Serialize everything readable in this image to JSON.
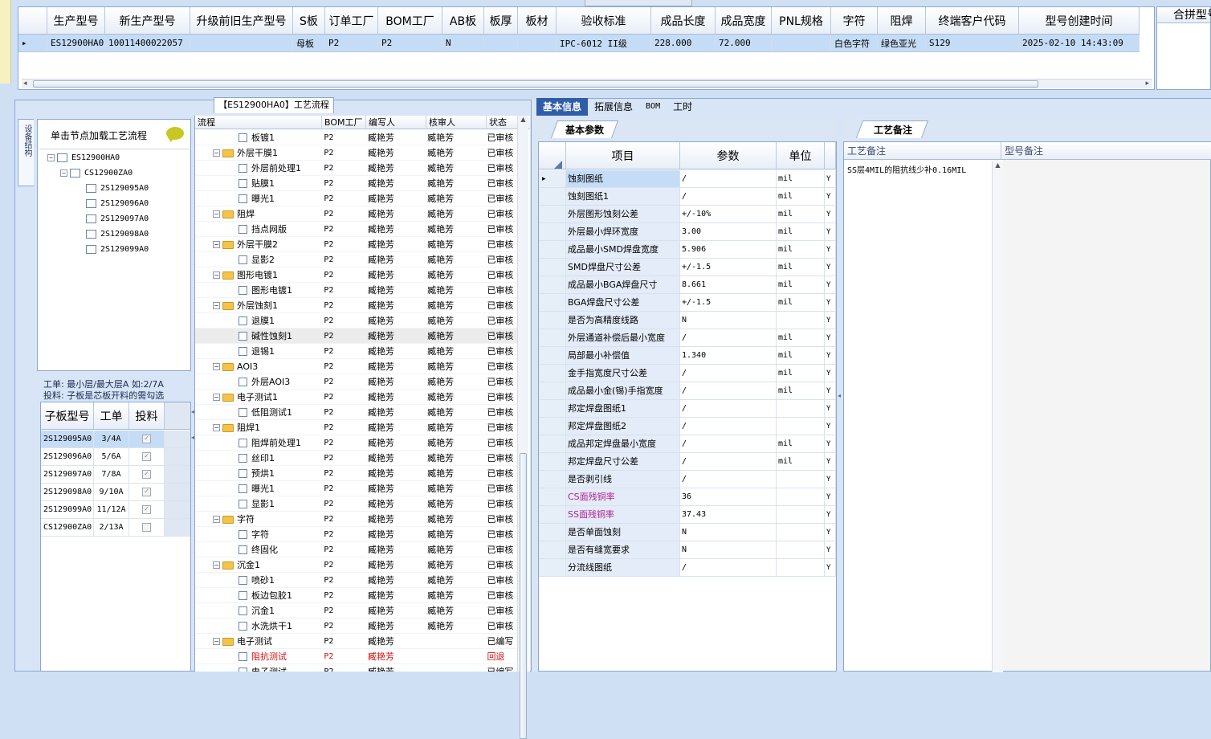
{
  "top_grid": {
    "columns": [
      "生产型号",
      "新生产型号",
      "升级前旧生产型号",
      "S板",
      "订单工厂",
      "BOM工厂",
      "AB板",
      "板厚",
      "板材",
      "验收标准",
      "成品长度",
      "成品宽度",
      "PNL规格",
      "字符",
      "阻焊",
      "终端客户代码",
      "型号创建时间"
    ],
    "row": [
      "ES12900HA0",
      "10011400022057",
      "",
      "母板",
      "P2",
      "P2",
      "N",
      "",
      "",
      "IPC-6012 II级",
      "228.000",
      "72.000",
      "",
      "白色字符",
      "绿色亚光",
      "S129",
      "2025-02-10 14:43:09"
    ],
    "right_header": "合拼型号"
  },
  "left_panel": {
    "vertical_tab": "设备结构",
    "hint": "单击节点加载工艺流程",
    "tree_root": "ES12900HA0",
    "tree_child": "CS12900ZA0",
    "tree_leaves": [
      "2S129095A0",
      "2S129096A0",
      "2S129097A0",
      "2S129098A0",
      "2S129099A0"
    ],
    "note_line1": "工单: 最小层/最大层A 如:2/7A",
    "note_line2": "投料: 子板是芯板开料的需勾选",
    "sub_columns": [
      "子板型号",
      "工单",
      "投料"
    ],
    "sub_rows": [
      {
        "model": "2S129095A0",
        "order": "3/4A",
        "checked": true
      },
      {
        "model": "2S129096A0",
        "order": "5/6A",
        "checked": true
      },
      {
        "model": "2S129097A0",
        "order": "7/8A",
        "checked": true
      },
      {
        "model": "2S129098A0",
        "order": "9/10A",
        "checked": true
      },
      {
        "model": "2S129099A0",
        "order": "11/12A",
        "checked": true
      },
      {
        "model": "CS12900ZA0",
        "order": "2/13A",
        "checked": false
      }
    ]
  },
  "flow_panel": {
    "title": "【ES12900HA0】工艺流程",
    "columns": [
      "流程",
      "BOM工厂",
      "编写人",
      "核审人",
      "状态"
    ],
    "rows": [
      {
        "name": "板镀1",
        "level": 2,
        "bom": "P2",
        "writer": "臧艳芳",
        "checker": "臧艳芳",
        "status": "已审核"
      },
      {
        "name": "外层干膜1",
        "level": 1,
        "bom": "P2",
        "writer": "臧艳芳",
        "checker": "臧艳芳",
        "status": "已审核"
      },
      {
        "name": "外层前处理1",
        "level": 2,
        "bom": "P2",
        "writer": "臧艳芳",
        "checker": "臧艳芳",
        "status": "已审核"
      },
      {
        "name": "贴膜1",
        "level": 2,
        "bom": "P2",
        "writer": "臧艳芳",
        "checker": "臧艳芳",
        "status": "已审核"
      },
      {
        "name": "曝光1",
        "level": 2,
        "bom": "P2",
        "writer": "臧艳芳",
        "checker": "臧艳芳",
        "status": "已审核"
      },
      {
        "name": "阻焊",
        "level": 1,
        "bom": "P2",
        "writer": "臧艳芳",
        "checker": "臧艳芳",
        "status": "已审核"
      },
      {
        "name": "挡点网版",
        "level": 2,
        "bom": "P2",
        "writer": "臧艳芳",
        "checker": "臧艳芳",
        "status": "已审核"
      },
      {
        "name": "外层干膜2",
        "level": 1,
        "bom": "P2",
        "writer": "臧艳芳",
        "checker": "臧艳芳",
        "status": "已审核"
      },
      {
        "name": "显影2",
        "level": 2,
        "bom": "P2",
        "writer": "臧艳芳",
        "checker": "臧艳芳",
        "status": "已审核"
      },
      {
        "name": "图形电镀1",
        "level": 1,
        "bom": "P2",
        "writer": "臧艳芳",
        "checker": "臧艳芳",
        "status": "已审核"
      },
      {
        "name": "图形电镀1",
        "level": 2,
        "bom": "P2",
        "writer": "臧艳芳",
        "checker": "臧艳芳",
        "status": "已审核"
      },
      {
        "name": "外层蚀刻1",
        "level": 1,
        "bom": "P2",
        "writer": "臧艳芳",
        "checker": "臧艳芳",
        "status": "已审核"
      },
      {
        "name": "退膜1",
        "level": 2,
        "bom": "P2",
        "writer": "臧艳芳",
        "checker": "臧艳芳",
        "status": "已审核"
      },
      {
        "name": "碱性蚀刻1",
        "level": 2,
        "bom": "P2",
        "writer": "臧艳芳",
        "checker": "臧艳芳",
        "status": "已审核",
        "selected": true
      },
      {
        "name": "退锡1",
        "level": 2,
        "bom": "P2",
        "writer": "臧艳芳",
        "checker": "臧艳芳",
        "status": "已审核"
      },
      {
        "name": "AOI3",
        "level": 1,
        "bom": "P2",
        "writer": "臧艳芳",
        "checker": "臧艳芳",
        "status": "已审核"
      },
      {
        "name": "外层AOI3",
        "level": 2,
        "bom": "P2",
        "writer": "臧艳芳",
        "checker": "臧艳芳",
        "status": "已审核"
      },
      {
        "name": "电子测试1",
        "level": 1,
        "bom": "P2",
        "writer": "臧艳芳",
        "checker": "臧艳芳",
        "status": "已审核"
      },
      {
        "name": "低阻测试1",
        "level": 2,
        "bom": "P2",
        "writer": "臧艳芳",
        "checker": "臧艳芳",
        "status": "已审核"
      },
      {
        "name": "阻焊1",
        "level": 1,
        "bom": "P2",
        "writer": "臧艳芳",
        "checker": "臧艳芳",
        "status": "已审核"
      },
      {
        "name": "阻焊前处理1",
        "level": 2,
        "bom": "P2",
        "writer": "臧艳芳",
        "checker": "臧艳芳",
        "status": "已审核"
      },
      {
        "name": "丝印1",
        "level": 2,
        "bom": "P2",
        "writer": "臧艳芳",
        "checker": "臧艳芳",
        "status": "已审核"
      },
      {
        "name": "预烘1",
        "level": 2,
        "bom": "P2",
        "writer": "臧艳芳",
        "checker": "臧艳芳",
        "status": "已审核"
      },
      {
        "name": "曝光1",
        "level": 2,
        "bom": "P2",
        "writer": "臧艳芳",
        "checker": "臧艳芳",
        "status": "已审核"
      },
      {
        "name": "显影1",
        "level": 2,
        "bom": "P2",
        "writer": "臧艳芳",
        "checker": "臧艳芳",
        "status": "已审核"
      },
      {
        "name": "字符",
        "level": 1,
        "bom": "P2",
        "writer": "臧艳芳",
        "checker": "臧艳芳",
        "status": "已审核"
      },
      {
        "name": "字符",
        "level": 2,
        "bom": "P2",
        "writer": "臧艳芳",
        "checker": "臧艳芳",
        "status": "已审核"
      },
      {
        "name": "终固化",
        "level": 2,
        "bom": "P2",
        "writer": "臧艳芳",
        "checker": "臧艳芳",
        "status": "已审核"
      },
      {
        "name": "沉金1",
        "level": 1,
        "bom": "P2",
        "writer": "臧艳芳",
        "checker": "臧艳芳",
        "status": "已审核"
      },
      {
        "name": "喷砂1",
        "level": 2,
        "bom": "P2",
        "writer": "臧艳芳",
        "checker": "臧艳芳",
        "status": "已审核"
      },
      {
        "name": "板边包胶1",
        "level": 2,
        "bom": "P2",
        "writer": "臧艳芳",
        "checker": "臧艳芳",
        "status": "已审核"
      },
      {
        "name": "沉金1",
        "level": 2,
        "bom": "P2",
        "writer": "臧艳芳",
        "checker": "臧艳芳",
        "status": "已审核"
      },
      {
        "name": "水洗烘干1",
        "level": 2,
        "bom": "P2",
        "writer": "臧艳芳",
        "checker": "臧艳芳",
        "status": "已审核"
      },
      {
        "name": "电子测试",
        "level": 1,
        "bom": "P2",
        "writer": "臧艳芳",
        "checker": "",
        "status": "已编写"
      },
      {
        "name": "阻抗测试",
        "level": 2,
        "bom": "P2",
        "writer": "臧艳芳",
        "checker": "",
        "status": "回退",
        "red": true
      },
      {
        "name": "电子测试",
        "level": 2,
        "bom": "P2",
        "writer": "臧艳芳",
        "checker": "",
        "status": "已编写"
      }
    ]
  },
  "right_tabs": [
    "基本信息",
    "拓展信息",
    "BOM",
    "工时"
  ],
  "params_tab": "基本参数",
  "params": {
    "columns": [
      "项目",
      "参数",
      "单位"
    ],
    "rows": [
      {
        "item": "蚀刻图纸",
        "param": "/",
        "unit": "mil",
        "flag": "Y",
        "current": true
      },
      {
        "item": "蚀刻图纸1",
        "param": "/",
        "unit": "mil",
        "flag": "Y"
      },
      {
        "item": "外层图形蚀刻公差",
        "param": "+/-10%",
        "unit": "mil",
        "flag": "Y"
      },
      {
        "item": "外层最小焊环宽度",
        "param": "3.00",
        "unit": "mil",
        "flag": "Y"
      },
      {
        "item": "成品最小SMD焊盘宽度",
        "param": "5.906",
        "unit": "mil",
        "flag": "Y"
      },
      {
        "item": "SMD焊盘尺寸公差",
        "param": "+/-1.5",
        "unit": "mil",
        "flag": "Y"
      },
      {
        "item": "成品最小BGA焊盘尺寸",
        "param": "8.661",
        "unit": "mil",
        "flag": "Y"
      },
      {
        "item": "BGA焊盘尺寸公差",
        "param": "+/-1.5",
        "unit": "mil",
        "flag": "Y"
      },
      {
        "item": "是否为高精度线路",
        "param": "N",
        "unit": "",
        "flag": "Y"
      },
      {
        "item": "外层通道补偿后最小宽度",
        "param": "/",
        "unit": "mil",
        "flag": "Y"
      },
      {
        "item": "局部最小补偿值",
        "param": "1.340",
        "unit": "mil",
        "flag": "Y"
      },
      {
        "item": "金手指宽度尺寸公差",
        "param": "/",
        "unit": "mil",
        "flag": "Y"
      },
      {
        "item": "成品最小金(锡)手指宽度",
        "param": "/",
        "unit": "mil",
        "flag": "Y"
      },
      {
        "item": "邦定焊盘图纸1",
        "param": "/",
        "unit": "",
        "flag": "Y"
      },
      {
        "item": "邦定焊盘图纸2",
        "param": "/",
        "unit": "",
        "flag": "Y"
      },
      {
        "item": "成品邦定焊盘最小宽度",
        "param": "/",
        "unit": "mil",
        "flag": "Y"
      },
      {
        "item": "邦定焊盘尺寸公差",
        "param": "/",
        "unit": "mil",
        "flag": "Y"
      },
      {
        "item": "是否剥引线",
        "param": "/",
        "unit": "",
        "flag": "Y"
      },
      {
        "item": "CS面残铜率",
        "param": "36",
        "unit": "",
        "flag": "Y",
        "pink": true
      },
      {
        "item": "SS面残铜率",
        "param": "37.43",
        "unit": "",
        "flag": "Y",
        "pink": true
      },
      {
        "item": "是否单面蚀刻",
        "param": "N",
        "unit": "",
        "flag": "Y"
      },
      {
        "item": "是否有缝宽要求",
        "param": "N",
        "unit": "",
        "flag": "Y"
      },
      {
        "item": "分流线图纸",
        "param": "/",
        "unit": "",
        "flag": "Y"
      }
    ]
  },
  "remark_tab": "工艺备注",
  "remark_columns": [
    "工艺备注",
    "型号备注"
  ],
  "remark_text": "SS层4MIL的阻抗线少补0.16MIL"
}
